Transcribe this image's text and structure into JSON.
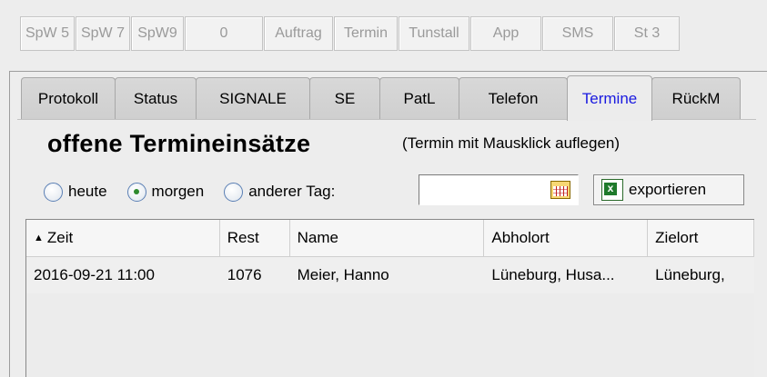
{
  "topbar": {
    "buttons": [
      {
        "label": "SpW 5"
      },
      {
        "label": "SpW 7"
      },
      {
        "label": "SpW9"
      },
      {
        "label": "0"
      },
      {
        "label": "Auftrag"
      },
      {
        "label": "Termin"
      },
      {
        "label": "Tunstall"
      },
      {
        "label": "App"
      },
      {
        "label": "SMS"
      },
      {
        "label": "St 3"
      }
    ]
  },
  "tabs": [
    {
      "label": "Protokoll"
    },
    {
      "label": "Status"
    },
    {
      "label": "SIGNALE"
    },
    {
      "label": "SE"
    },
    {
      "label": "PatL"
    },
    {
      "label": "Telefon"
    },
    {
      "label": "Termine",
      "active": true
    },
    {
      "label": "RückM"
    }
  ],
  "main": {
    "title": "offene Termineinsätze",
    "hint": "(Termin mit Mausklick auflegen)",
    "radios": [
      {
        "label": "heute",
        "selected": false
      },
      {
        "label": "morgen",
        "selected": true
      },
      {
        "label": "anderer Tag:",
        "selected": false
      }
    ],
    "date_value": "",
    "export_label": "exportieren"
  },
  "table": {
    "columns": [
      "Zeit",
      "Rest",
      "Name",
      "Abholort",
      "Zielort"
    ],
    "sort_indicator": "▲",
    "rows": [
      [
        "2016-09-21 11:00",
        "1076",
        "Meier, Hanno",
        "Lüneburg, Husa...",
        "Lüneburg,"
      ]
    ]
  },
  "colors": {
    "active_tab_text": "#1a1ae0",
    "disabled_button_text": "#9a9a9a"
  }
}
